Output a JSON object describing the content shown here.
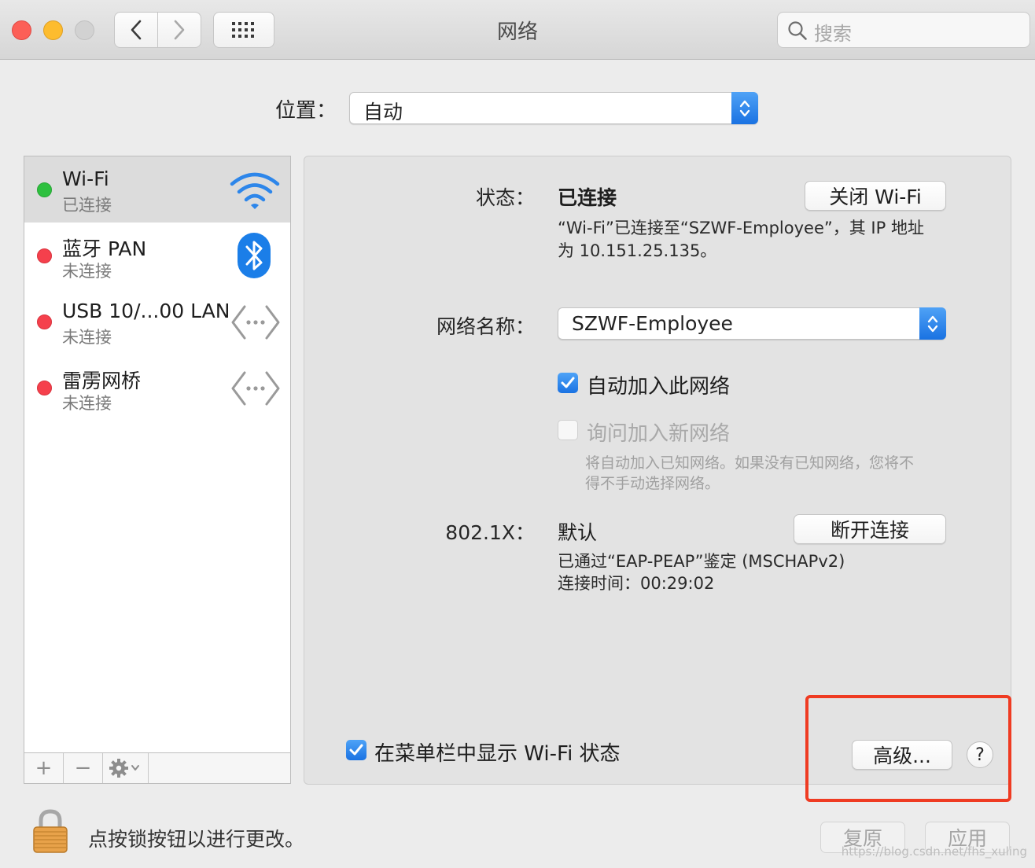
{
  "window": {
    "title": "网络",
    "search_placeholder": "搜索"
  },
  "location": {
    "label": "位置：",
    "value": "自动"
  },
  "services": [
    {
      "name": "Wi-Fi",
      "status": "已连接",
      "icon": "wifi-icon",
      "status_color": "#2ec03f"
    },
    {
      "name": "蓝牙 PAN",
      "status": "未连接",
      "icon": "bluetooth-icon",
      "status_color": "#f5404c"
    },
    {
      "name": "USB 10/...00 LAN",
      "status": "未连接",
      "icon": "ethernet-icon",
      "status_color": "#f5404c"
    },
    {
      "name": "雷雳网桥",
      "status": "未连接",
      "icon": "ethernet-icon",
      "status_color": "#f5404c"
    }
  ],
  "detail": {
    "status_label": "状态：",
    "status_value": "已连接",
    "wifi_off_button": "关闭 Wi-Fi",
    "status_desc_line1": "“Wi-Fi”已连接至“SZWF-Employee”，其 IP 地址",
    "status_desc_line2": "为 10.151.25.135。",
    "network_name_label": "网络名称：",
    "network_name_value": "SZWF-Employee",
    "auto_join_label": "自动加入此网络",
    "ask_join_label": "询问加入新网络",
    "ask_join_hint_line1": "将自动加入已知网络。如果没有已知网络，您将不",
    "ask_join_hint_line2": "得不手动选择网络。",
    "dot1x_label": "802.1X：",
    "dot1x_value": "默认",
    "disconnect_button": "断开连接",
    "dot1x_desc_line1": "已通过“EAP-PEAP”鉴定 (MSCHAPv2)",
    "dot1x_desc_line2": "连接时间：00:29:02",
    "show_menu_label": "在菜单栏中显示 Wi-Fi 状态",
    "advanced_button": "高级...",
    "help_button": "?"
  },
  "checkboxes": {
    "auto_join": true,
    "ask_join": false,
    "show_menu": true
  },
  "sidebar_footer": {
    "add": "+",
    "remove": "−"
  },
  "footer": {
    "lock_text": "点按锁按钮以进行更改。",
    "revert_button": "复原",
    "apply_button": "应用",
    "watermark": "https://blog.csdn.net/fhs_xuling"
  },
  "colors": {
    "accent": "#1a72e2",
    "highlight_box": "#ef3b22"
  }
}
